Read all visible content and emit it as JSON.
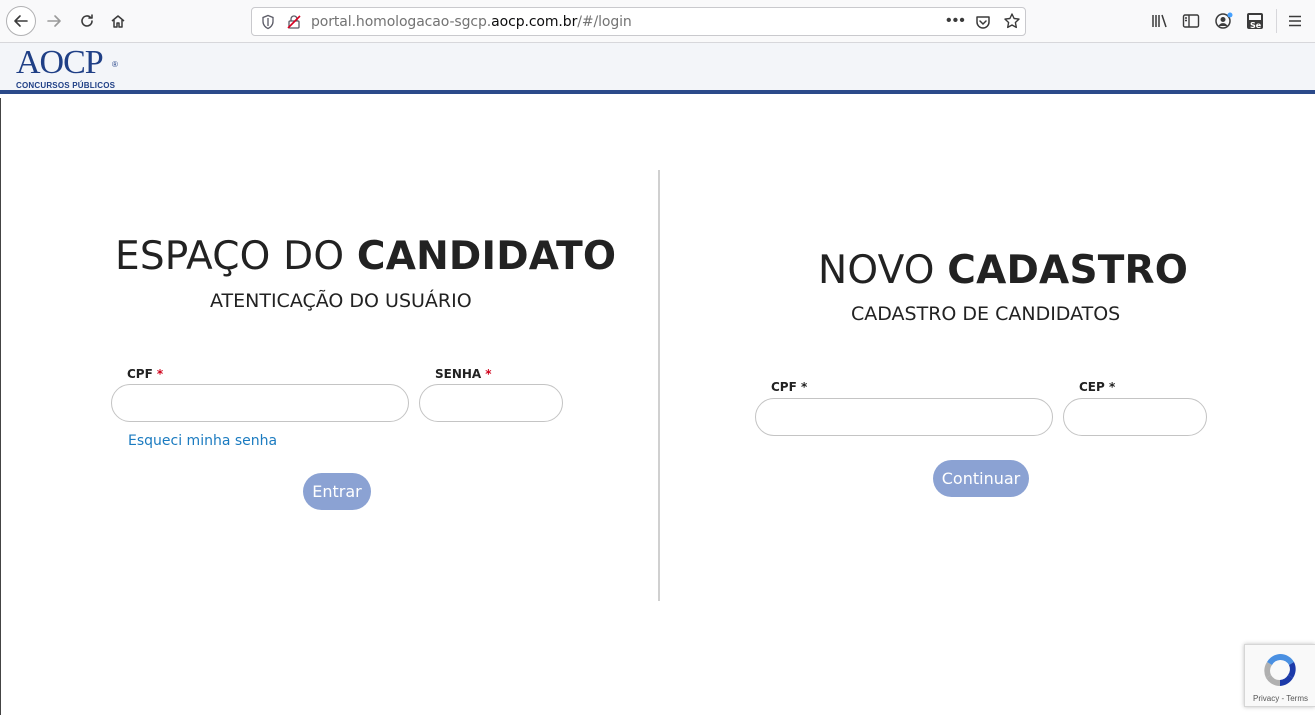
{
  "browser": {
    "url_prefix": "portal.homologacao-sgcp.",
    "url_domain": "aocp.com.br",
    "url_suffix": "/#/login",
    "more_label": "•••"
  },
  "header": {
    "logo_text": "AOCP",
    "logo_reg": "®",
    "logo_sub": "CONCURSOS PÚBLICOS",
    "brand_color": "#1f3f86"
  },
  "login": {
    "title_light": "ESPAÇO DO ",
    "title_bold": "CANDIDATO",
    "subtitle": "ATENTICAÇÃO DO USUÁRIO",
    "cpf_label": "CPF",
    "senha_label": "SENHA",
    "required_mark": "*",
    "cpf_value": "",
    "senha_value": "",
    "forgot_link": "Esqueci minha senha",
    "submit_label": "Entrar"
  },
  "register": {
    "title_light": "NOVO ",
    "title_bold": "CADASTRO",
    "subtitle": "CADASTRO DE CANDIDATOS",
    "cpf_label": "CPF *",
    "cep_label": "CEP *",
    "cpf_value": "",
    "cep_value": "",
    "submit_label": "Continuar"
  },
  "recaptcha": {
    "footer": "Privacy - Terms"
  },
  "colors": {
    "button": "#8ba2d3",
    "link": "#1b7bc0",
    "required": "#d0021b",
    "header_border": "#2b4a8a"
  }
}
